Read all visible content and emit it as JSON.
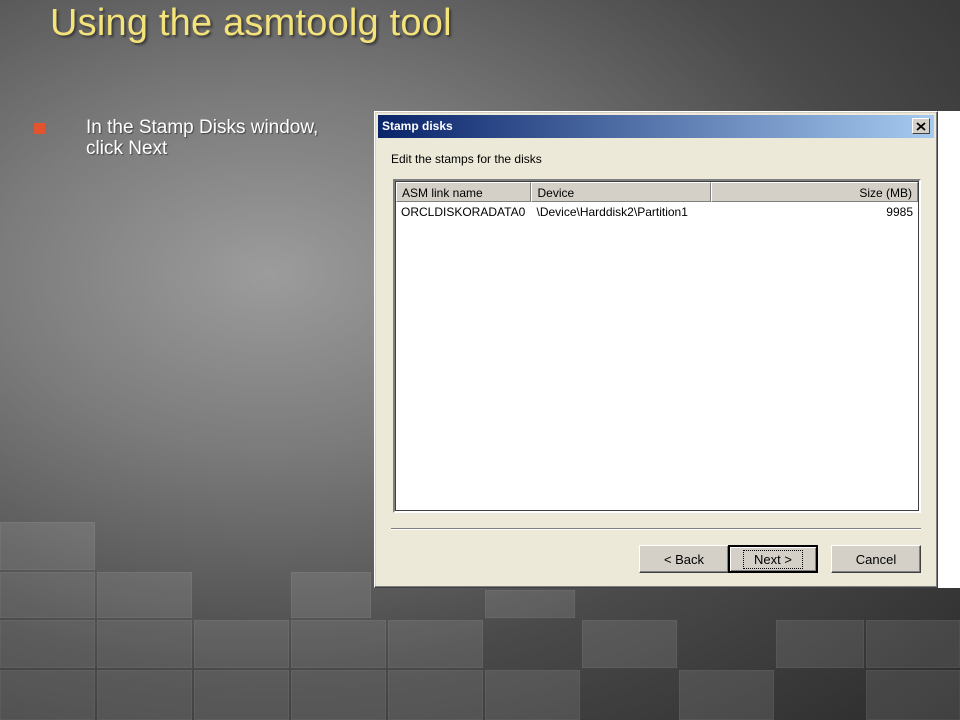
{
  "slide": {
    "title": "Using the asmtoolg tool",
    "bullet": "In the Stamp Disks window, click Next"
  },
  "dialog": {
    "title": "Stamp disks",
    "instruction": "Edit the stamps for the disks",
    "columns": [
      "ASM link name",
      "Device",
      "Size (MB)"
    ],
    "rows": [
      {
        "link": "ORCLDISKORADATA0",
        "device": "\\Device\\Harddisk2\\Partition1",
        "size": "9985"
      }
    ],
    "buttons": {
      "back": "< Back",
      "next": "Next >",
      "cancel": "Cancel"
    }
  },
  "icons": {
    "close": "close-icon",
    "bullet": "square-bullet-icon"
  },
  "colors": {
    "title": "#f4e27a",
    "bullet": "#e3532e",
    "titlebar_start": "#0a246a",
    "titlebar_end": "#a6caf0"
  }
}
